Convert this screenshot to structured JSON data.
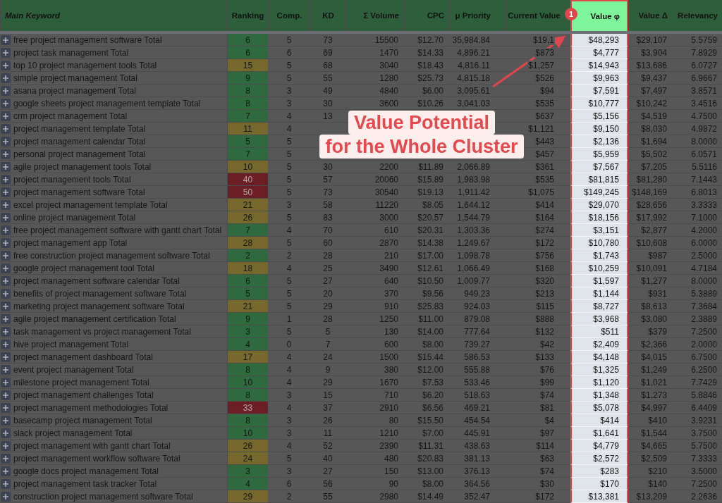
{
  "table": {
    "columns": [
      {
        "label": "Main Keyword",
        "selected": false
      },
      {
        "label": "Ranking",
        "selected": false
      },
      {
        "label": "Comp.",
        "selected": false
      },
      {
        "label": "KD",
        "selected": false
      },
      {
        "label": "Σ Volume",
        "selected": false
      },
      {
        "label": "CPC",
        "selected": false
      },
      {
        "label": "μ Priority",
        "selected": false
      },
      {
        "label": "Current Value",
        "selected": false
      },
      {
        "label": "Value φ",
        "selected": true
      },
      {
        "label": "Value Δ",
        "selected": false
      },
      {
        "label": "Relevancy",
        "selected": false
      }
    ],
    "rows": [
      {
        "color": "#2e6a3e",
        "cells": [
          "free project management software Total",
          "6",
          "5",
          "73",
          "15500",
          "$12.70",
          "35,984.84",
          "$19,1",
          "$48,293",
          "$29,107",
          "5.5759"
        ]
      },
      {
        "color": "#2e6a3e",
        "cells": [
          "project task management Total",
          "6",
          "6",
          "69",
          "1470",
          "$14.33",
          "4,896.21",
          "$873",
          "$4,777",
          "$3,904",
          "7.8929"
        ]
      },
      {
        "color": "#77692e",
        "cells": [
          "top 10 project management tools Total",
          "15",
          "5",
          "68",
          "3040",
          "$18.43",
          "4,816.11",
          "$1,257",
          "$14,943",
          "$13,686",
          "6.0727"
        ]
      },
      {
        "color": "#2e6a3e",
        "cells": [
          "simple project management Total",
          "9",
          "5",
          "55",
          "1280",
          "$25.73",
          "4,815.18",
          "$526",
          "$9,963",
          "$9,437",
          "6.9667"
        ]
      },
      {
        "color": "#2e6a3e",
        "cells": [
          "asana project management Total",
          "8",
          "3",
          "49",
          "4840",
          "$6.00",
          "3,095.61",
          "$94",
          "$7,591",
          "$7,497",
          "3.8571"
        ]
      },
      {
        "color": "#2e6a3e",
        "cells": [
          "google sheets project management template Total",
          "8",
          "3",
          "30",
          "3600",
          "$10.26",
          "3,041.03",
          "$535",
          "$10,777",
          "$10,242",
          "3.4516"
        ]
      },
      {
        "color": "#2e6a3e",
        "cells": [
          "crm project management Total",
          "7",
          "4",
          "13",
          null,
          null,
          null,
          "$637",
          "$5,156",
          "$4,519",
          "4.7500"
        ]
      },
      {
        "color": "#77692e",
        "cells": [
          "project management template Total",
          "11",
          "4",
          null,
          null,
          null,
          null,
          "$1,121",
          "$9,150",
          "$8,030",
          "4.9872"
        ]
      },
      {
        "color": "#2e6a3e",
        "cells": [
          "project management calendar Total",
          "5",
          "5",
          null,
          null,
          null,
          null,
          "$443",
          "$2,136",
          "$1,694",
          "8.0000"
        ]
      },
      {
        "color": "#2e6a3e",
        "cells": [
          "personal project management Total",
          "7",
          "5",
          null,
          null,
          null,
          null,
          "$457",
          "$5,959",
          "$5,502",
          "6.0571"
        ]
      },
      {
        "color": "#77692e",
        "cells": [
          "agile project management tools Total",
          "10",
          "5",
          "30",
          "2200",
          "$11.89",
          "2,066.89",
          "$361",
          "$7,567",
          "$7,205",
          "5.5116"
        ]
      },
      {
        "color": "#6b1f25",
        "cells": [
          "project management tools Total",
          "40",
          "5",
          "57",
          "20060",
          "$15.89",
          "1,983.98",
          "$535",
          "$81,815",
          "$81,280",
          "7.1443"
        ]
      },
      {
        "color": "#6b1f25",
        "cells": [
          "project management software Total",
          "50",
          "5",
          "73",
          "30540",
          "$19.13",
          "1,911.42",
          "$1,075",
          "$149,245",
          "$148,169",
          "6.8013"
        ]
      },
      {
        "color": "#77692e",
        "cells": [
          "excel project management template Total",
          "21",
          "3",
          "58",
          "11220",
          "$8.05",
          "1,644.12",
          "$414",
          "$29,070",
          "$28,656",
          "3.3333"
        ]
      },
      {
        "color": "#77692e",
        "cells": [
          "online project management Total",
          "26",
          "5",
          "83",
          "3000",
          "$20.57",
          "1,544.79",
          "$164",
          "$18,156",
          "$17,992",
          "7.1000"
        ]
      },
      {
        "color": "#2e6a3e",
        "cells": [
          "free project management software with gantt chart Total",
          "7",
          "4",
          "70",
          "610",
          "$20.31",
          "1,303.36",
          "$274",
          "$3,151",
          "$2,877",
          "4.2000"
        ]
      },
      {
        "color": "#77692e",
        "cells": [
          "project management app Total",
          "28",
          "5",
          "60",
          "2870",
          "$14.38",
          "1,249.67",
          "$172",
          "$10,780",
          "$10,608",
          "6.0000"
        ]
      },
      {
        "color": "#2e6a3e",
        "cells": [
          "free construction project management software Total",
          "2",
          "2",
          "28",
          "210",
          "$17.00",
          "1,098.78",
          "$756",
          "$1,743",
          "$987",
          "2.5000"
        ]
      },
      {
        "color": "#77692e",
        "cells": [
          "google project management tool Total",
          "18",
          "4",
          "25",
          "3490",
          "$12.61",
          "1,066.49",
          "$168",
          "$10,259",
          "$10,091",
          "4.7184"
        ]
      },
      {
        "color": "#2e6a3e",
        "cells": [
          "project management software calendar Total",
          "6",
          "5",
          "27",
          "640",
          "$10.50",
          "1,009.77",
          "$320",
          "$1,597",
          "$1,277",
          "8.0000"
        ]
      },
      {
        "color": "#2e6a3e",
        "cells": [
          "benefits of project management software Total",
          "5",
          "5",
          "20",
          "370",
          "$9.56",
          "949.23",
          "$213",
          "$1,144",
          "$931",
          "5.3889"
        ]
      },
      {
        "color": "#77692e",
        "cells": [
          "marketing project management software Total",
          "21",
          "5",
          "29",
          "910",
          "$25.83",
          "924.03",
          "$115",
          "$8,727",
          "$8,613",
          "7.3684"
        ]
      },
      {
        "color": "#2e6a3e",
        "cells": [
          "agile project management certification Total",
          "9",
          "1",
          "28",
          "1250",
          "$11.00",
          "879.08",
          "$888",
          "$3,968",
          "$3,080",
          "2.3889"
        ]
      },
      {
        "color": "#2e6a3e",
        "cells": [
          "task management vs project management Total",
          "3",
          "5",
          "5",
          "130",
          "$14.00",
          "777.64",
          "$132",
          "$511",
          "$379",
          "7.2500"
        ]
      },
      {
        "color": "#2e6a3e",
        "cells": [
          "hive project management Total",
          "4",
          "0",
          "7",
          "600",
          "$8.00",
          "739.27",
          "$42",
          "$2,409",
          "$2,366",
          "2.0000"
        ]
      },
      {
        "color": "#77692e",
        "cells": [
          "project management dashboard Total",
          "17",
          "4",
          "24",
          "1500",
          "$15.44",
          "586.53",
          "$133",
          "$4,148",
          "$4,015",
          "6.7500"
        ]
      },
      {
        "color": "#2e6a3e",
        "cells": [
          "event project management Total",
          "8",
          "4",
          "9",
          "380",
          "$12.00",
          "555.88",
          "$76",
          "$1,325",
          "$1,249",
          "6.2500"
        ]
      },
      {
        "color": "#2e6a3e",
        "cells": [
          "milestone project management Total",
          "10",
          "4",
          "29",
          "1670",
          "$7.53",
          "533.46",
          "$99",
          "$1,120",
          "$1,021",
          "7.7429"
        ]
      },
      {
        "color": "#2e6a3e",
        "cells": [
          "project management challenges Total",
          "8",
          "3",
          "15",
          "710",
          "$6.20",
          "518.63",
          "$74",
          "$1,348",
          "$1,273",
          "5.8846"
        ]
      },
      {
        "color": "#6b1f25",
        "cells": [
          "project management methodologies Total",
          "33",
          "4",
          "37",
          "2910",
          "$6.56",
          "469.21",
          "$81",
          "$5,078",
          "$4,997",
          "6.4409"
        ]
      },
      {
        "color": "#2e6a3e",
        "cells": [
          "basecamp project management Total",
          "8",
          "3",
          "26",
          "80",
          "$15.50",
          "454.54",
          "$4",
          "$414",
          "$410",
          "3.9231"
        ]
      },
      {
        "color": "#2e6a3e",
        "cells": [
          "slack project management Total",
          "10",
          "3",
          "11",
          "1210",
          "$7.00",
          "445.91",
          "$97",
          "$1,641",
          "$1,544",
          "3.7500"
        ]
      },
      {
        "color": "#77692e",
        "cells": [
          "project management with gantt chart Total",
          "26",
          "4",
          "52",
          "2390",
          "$11.31",
          "438.63",
          "$114",
          "$4,779",
          "$4,665",
          "5.7500"
        ]
      },
      {
        "color": "#77692e",
        "cells": [
          "project management workflow software Total",
          "24",
          "5",
          "40",
          "480",
          "$20.83",
          "381.13",
          "$63",
          "$2,572",
          "$2,509",
          "7.3333"
        ]
      },
      {
        "color": "#2e6a3e",
        "cells": [
          "google docs project management Total",
          "3",
          "3",
          "27",
          "150",
          "$13.00",
          "376.13",
          "$74",
          "$283",
          "$210",
          "3.5000"
        ]
      },
      {
        "color": "#2e6a3e",
        "cells": [
          "project management task tracker Total",
          "4",
          "6",
          "56",
          "90",
          "$8.00",
          "364.56",
          "$30",
          "$170",
          "$140",
          "7.2500"
        ]
      },
      {
        "color": "#77692e",
        "cells": [
          "construction project management software Total",
          "29",
          "2",
          "55",
          "2980",
          "$14.49",
          "352.47",
          "$172",
          "$13,381",
          "$13,209",
          "2.2636"
        ]
      }
    ]
  },
  "callout": {
    "badge": "1",
    "lines": [
      "Value Potential",
      "for the Whole Cluster"
    ]
  }
}
